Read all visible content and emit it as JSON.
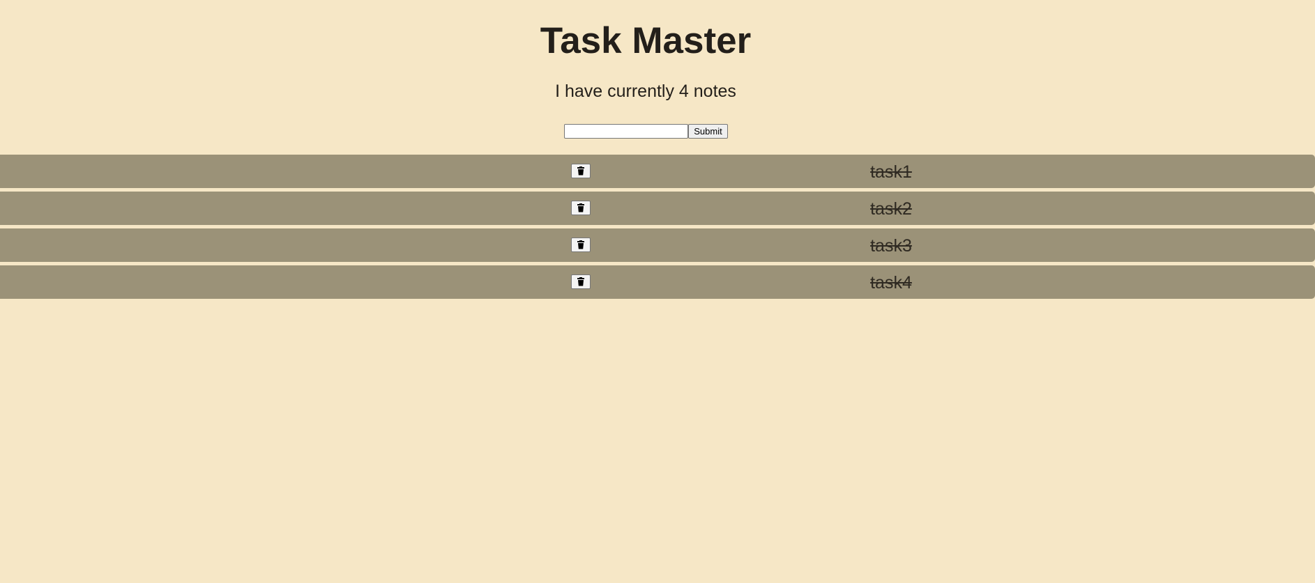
{
  "app": {
    "title": "Task Master",
    "status_text": "I have currently 4 notes"
  },
  "form": {
    "input_value": "",
    "input_placeholder": "",
    "submit_label": "Submit"
  },
  "tasks": [
    {
      "label": "task1",
      "completed": true,
      "delete_icon": "trash-icon"
    },
    {
      "label": "task2",
      "completed": true,
      "delete_icon": "trash-icon"
    },
    {
      "label": "task3",
      "completed": true,
      "delete_icon": "trash-icon"
    },
    {
      "label": "task4",
      "completed": true,
      "delete_icon": "trash-icon"
    }
  ],
  "colors": {
    "background": "#f6e7c6",
    "task_row": "#9b9278",
    "text": "#231f1a"
  }
}
